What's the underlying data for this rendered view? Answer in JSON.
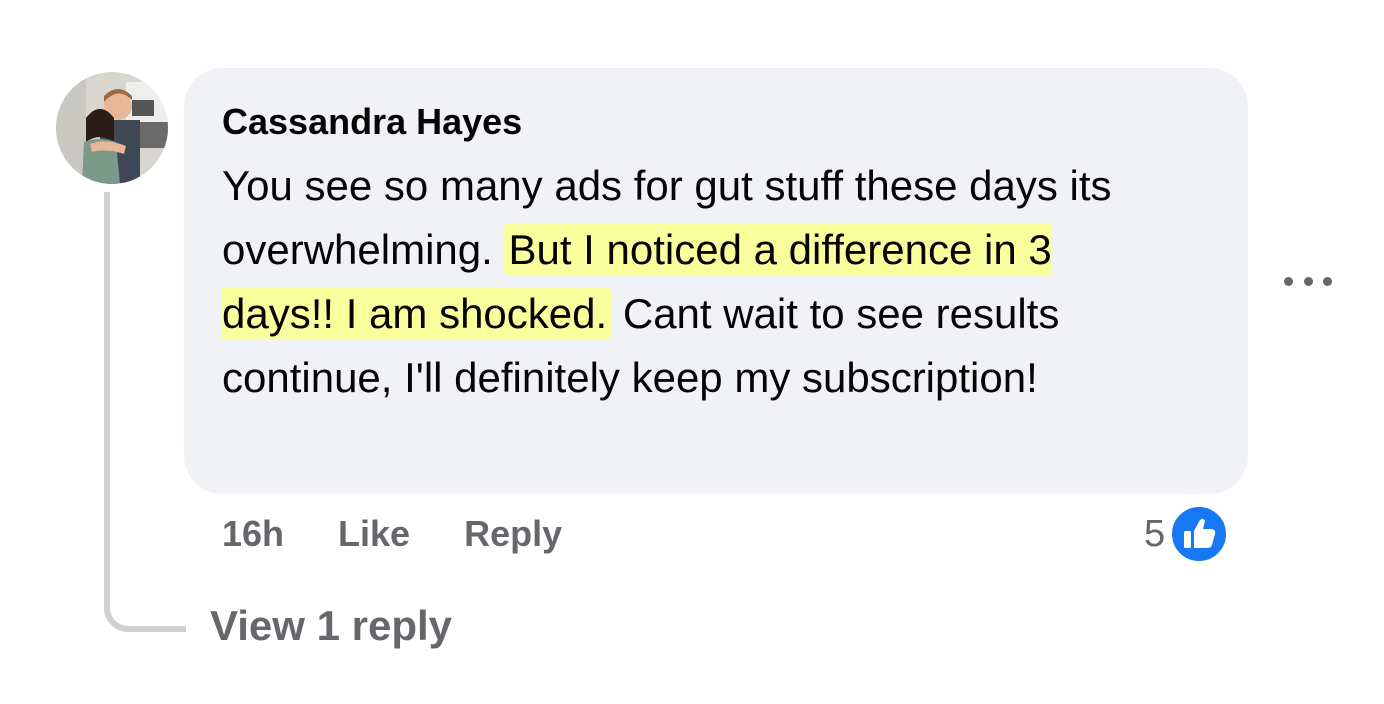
{
  "comment": {
    "author": "Cassandra Hayes",
    "text_before": "You see so many ads for gut stuff these days its overwhelming.",
    "text_highlight": "But I noticed a difference in 3 days!! I am shocked.",
    "text_after": "Cant wait to see results continue, I'll definitely keep my subscription!",
    "highlight_color": "#faff9e",
    "bubble_color": "#f0f2f5",
    "timestamp": "16h",
    "like_label": "Like",
    "reply_label": "Reply",
    "reaction_count": "5",
    "reaction_icon": "thumbs-up-icon",
    "reaction_color": "#1877f2",
    "more_icon": "more-horizontal-icon"
  },
  "replies": {
    "view_label": "View 1 reply"
  }
}
